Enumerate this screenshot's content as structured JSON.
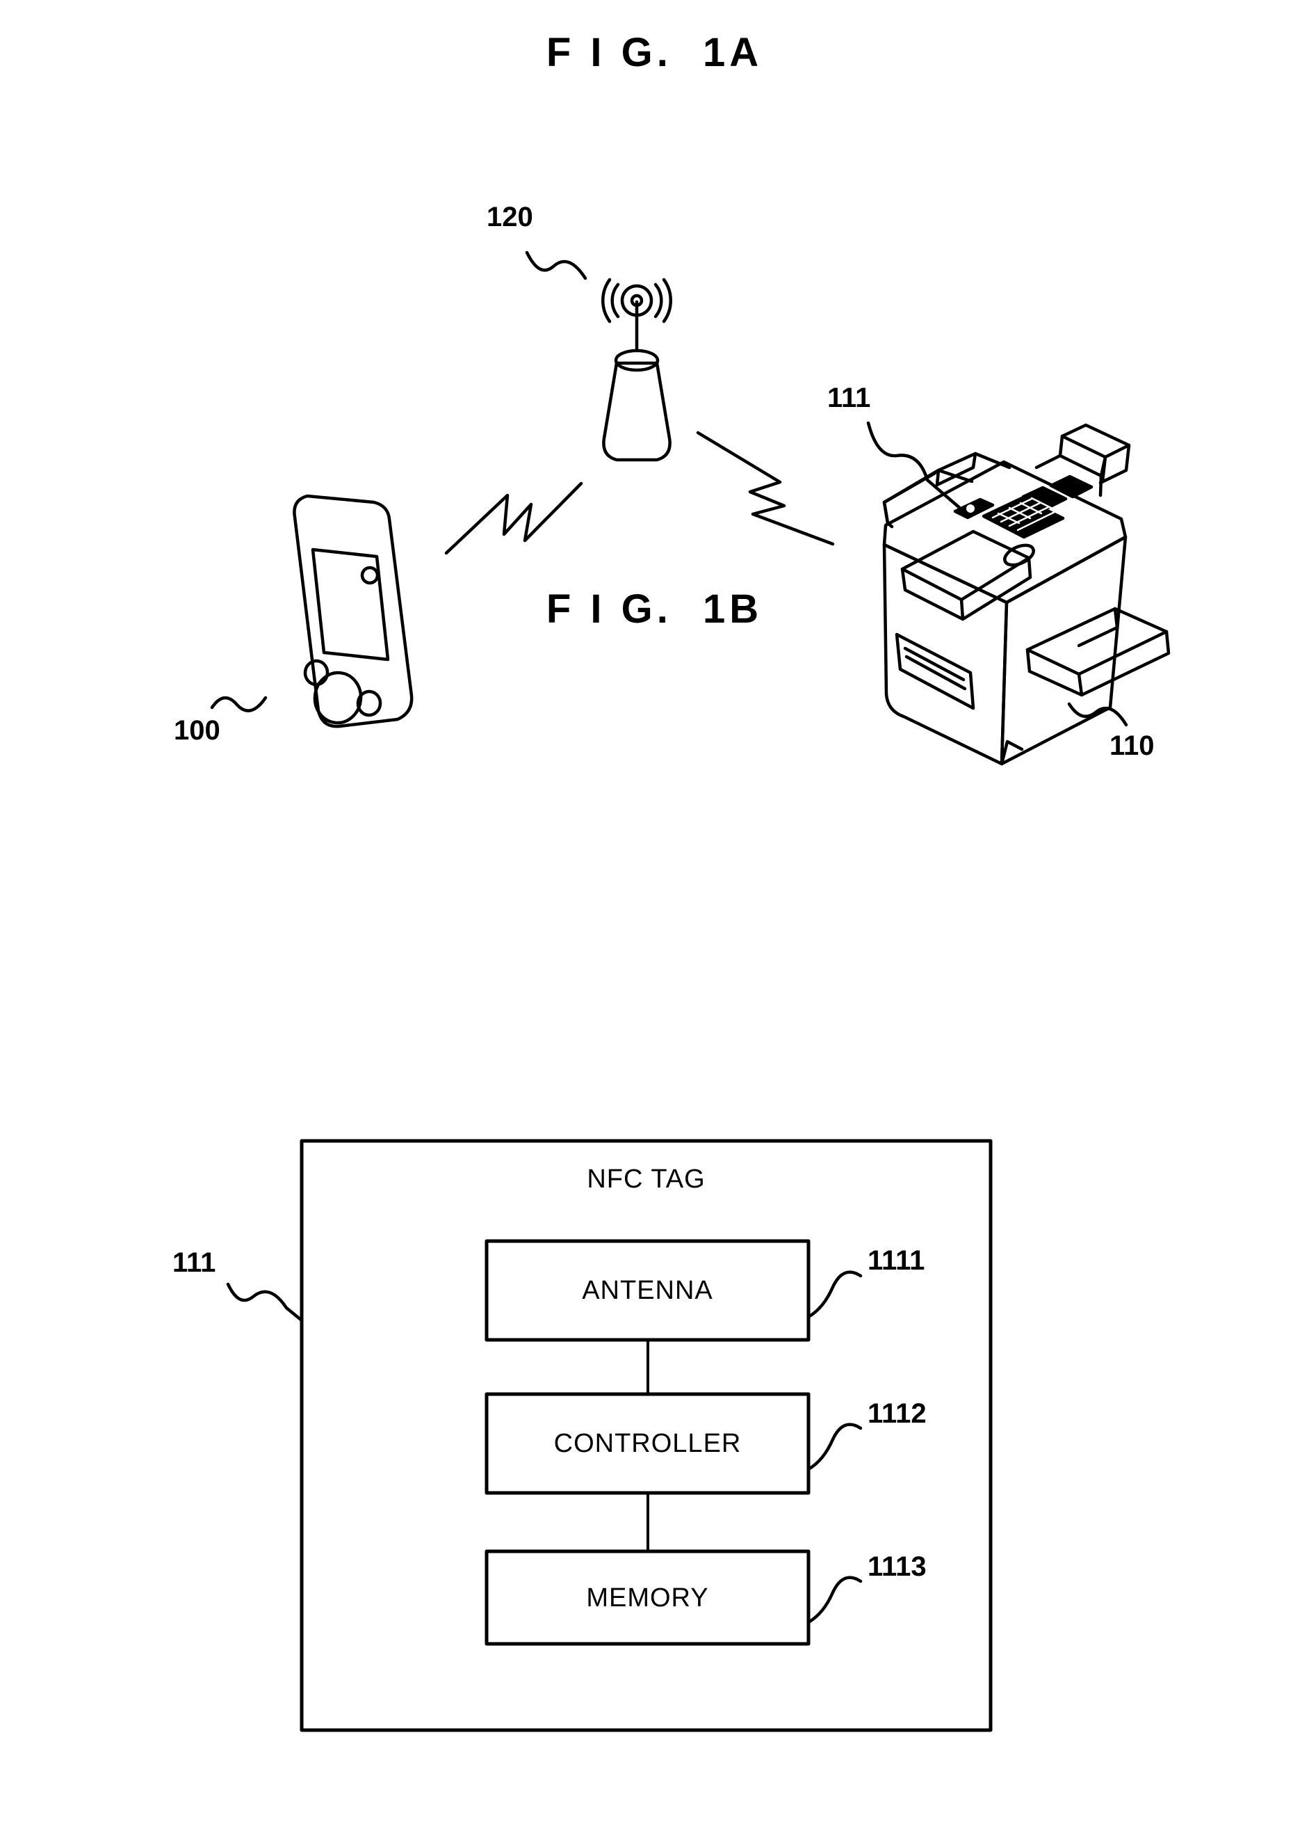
{
  "document": {
    "type": "patent-figure-sheet",
    "background_color": "#ffffff",
    "line_color": "#000000"
  },
  "figures": [
    {
      "id": "fig-1a",
      "title": "F I G.  1A",
      "kind": "system-overview-pictorial",
      "description": "Mobile terminal and multifunction printer communicating wirelessly through an access point",
      "elements": [
        {
          "name": "mobile-terminal",
          "icon": "mobile-phone-icon",
          "ref": "100",
          "ref_label": "100"
        },
        {
          "name": "access-point",
          "icon": "wireless-access-point-icon",
          "ref": "120",
          "ref_label": "120"
        },
        {
          "name": "multifunction-printer",
          "icon": "printer-icon",
          "ref": "110",
          "ref_label": "110"
        },
        {
          "name": "nfc-tag-on-printer",
          "icon": "nfc-tag-icon",
          "ref": "111",
          "ref_label": "111"
        },
        {
          "name": "wireless-link-phone-to-ap",
          "icon": "lightning-bolt-icon"
        },
        {
          "name": "wireless-link-ap-to-printer",
          "icon": "lightning-bolt-icon"
        }
      ],
      "ref_labels": {
        "access_point": "120",
        "nfc_tag": "111",
        "printer": "110",
        "mobile_terminal": "100"
      }
    },
    {
      "id": "fig-1b",
      "title": "F I G.  1B",
      "kind": "block-diagram",
      "outer_block": {
        "label": "NFC TAG",
        "ref_label": "111"
      },
      "inner_blocks": [
        {
          "label": "ANTENNA",
          "ref_label": "1111"
        },
        {
          "label": "CONTROLLER",
          "ref_label": "1112"
        },
        {
          "label": "MEMORY",
          "ref_label": "1113"
        }
      ],
      "connections": [
        {
          "from": "ANTENNA",
          "to": "CONTROLLER"
        },
        {
          "from": "CONTROLLER",
          "to": "MEMORY"
        }
      ]
    }
  ]
}
